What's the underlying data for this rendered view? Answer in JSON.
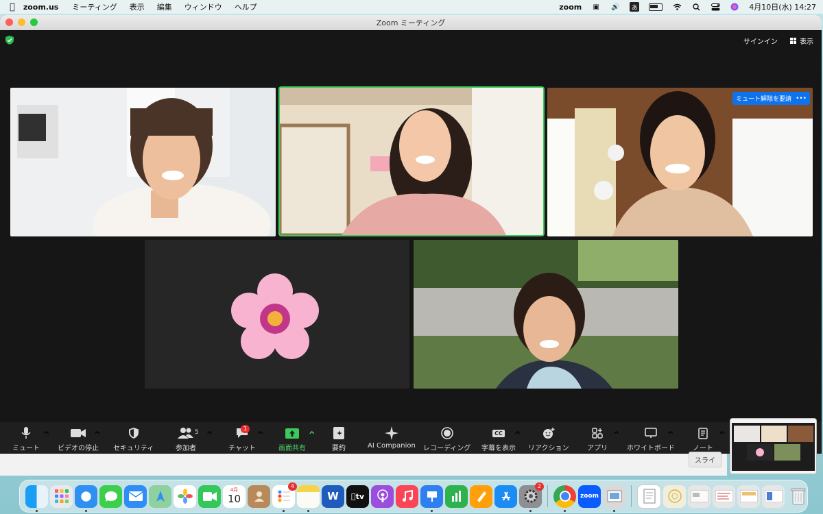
{
  "menubar": {
    "app_name": "zoom.us",
    "menus": [
      "ミーティング",
      "表示",
      "編集",
      "ウィンドウ",
      "ヘルプ"
    ],
    "zoom_status": "zoom",
    "input_method": "あ",
    "datetime": "4月10日(水)  14:27"
  },
  "window": {
    "title": "Zoom ミーティング",
    "sign_in": "サインイン",
    "view": "表示"
  },
  "participants_grid": {
    "ask_unmute": "ミュート解除を要請",
    "ask_unmute_more": "•••"
  },
  "toolbar": {
    "mute": "ミュート",
    "video": "ビデオの停止",
    "security": "セキュリティ",
    "participants": "参加者",
    "participants_count": "5",
    "chat": "チャット",
    "chat_badge": "1",
    "share": "画面共有",
    "summary": "要約",
    "ai": "AI Companion",
    "record": "レコーディング",
    "captions": "字幕を表示",
    "captions_icon": "CC",
    "reactions": "リアクション",
    "apps": "アプリ",
    "whiteboard": "ホワイトボード",
    "notes": "ノート"
  },
  "background_window": {
    "slide_label": "スライ"
  },
  "dock": {
    "calendar_month": "4月",
    "calendar_day": "10",
    "reminders_badge": "4",
    "settings_badge": "2",
    "tv_label": "tv",
    "word_label": "W",
    "zoom_label": "zoom"
  },
  "colors": {
    "active_speaker": "#3cc85a",
    "share_green": "#4ad06a",
    "badge_red": "#e5302f",
    "ask_unmute_blue": "#0e72ed"
  }
}
